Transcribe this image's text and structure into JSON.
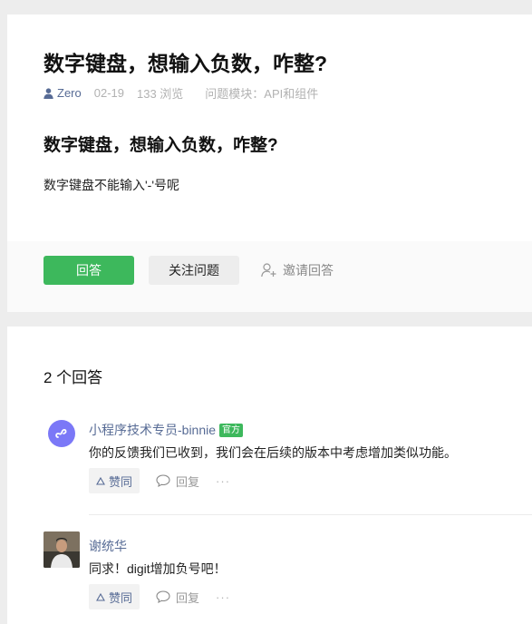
{
  "question": {
    "title": "数字键盘，想输入负数，咋整?",
    "author": "Zero",
    "date": "02-19",
    "views": "133 浏览",
    "category": "问题模块：API和组件",
    "body_heading": "数字键盘，想输入负数，咋整?",
    "body_text": "数字键盘不能输入'-'号呢"
  },
  "actions": {
    "answer_label": "回答",
    "follow_label": "关注问题",
    "invite_label": "邀请回答",
    "accent_color": "#3db85c"
  },
  "answers_section": {
    "count_label": "2 个回答"
  },
  "answers": [
    {
      "author": "小程序技术专员-binnie",
      "badge": "官方",
      "text": "你的反馈我们已收到，我们会在后续的版本中考虑增加类似功能。",
      "like_label": "赞同",
      "reply_label": "回复",
      "more_label": "···",
      "avatar_icon": "miniprogram-logo-icon"
    },
    {
      "author": "谢统华",
      "text": "同求！digit增加负号吧！",
      "like_label": "赞同",
      "reply_label": "回复",
      "more_label": "···",
      "avatar_icon": "user-photo"
    }
  ]
}
